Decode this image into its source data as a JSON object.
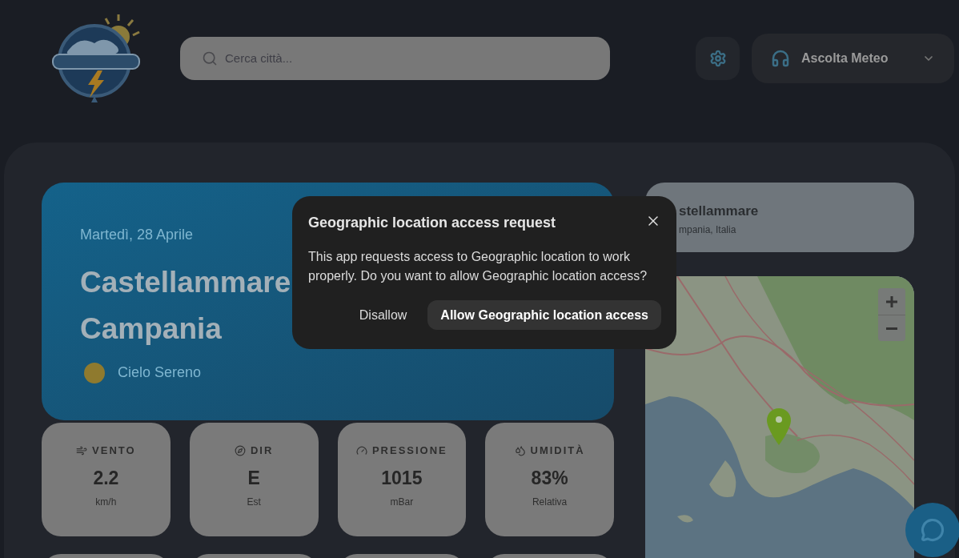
{
  "header": {
    "search": {
      "placeholder": "Cerca città..."
    },
    "listen_button": {
      "label": "Ascolta Meteo"
    }
  },
  "hero": {
    "date": "Martedì, 28 Aprile",
    "title_lines": [
      "Castellammare",
      "Campania"
    ],
    "condition": "Cielo Sereno"
  },
  "stats": [
    {
      "label": "VENTO",
      "value": "2.2",
      "unit": "km/h"
    },
    {
      "label": "DIR",
      "value": "E",
      "unit": "Est"
    },
    {
      "label": "PRESSIONE",
      "value": "1015",
      "unit": "mBar"
    },
    {
      "label": "UMIDITÀ",
      "value": "83%",
      "unit": "Relativa"
    }
  ],
  "location_card": {
    "name": "stellammare",
    "region": "mpania, Italia"
  },
  "dialog": {
    "title": "Geographic location access request",
    "message": "This app requests access to Geographic location to work properly. Do you want to allow Geographic location access?",
    "buttons": [
      {
        "label": "Disallow",
        "kind": "text"
      },
      {
        "label": "Allow Geographic location access",
        "kind": "filled"
      }
    ]
  }
}
